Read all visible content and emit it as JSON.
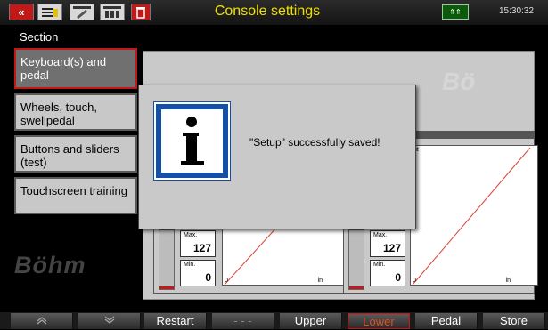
{
  "header": {
    "title": "Console settings",
    "back_label": "«",
    "transpose_label": "⇑⇑",
    "clock": "15:30:32"
  },
  "section_label": "Section",
  "sidebar": {
    "items": [
      {
        "label": "Keyboard(s) and pedal",
        "selected": true
      },
      {
        "label": "Wheels, touch, swellpedal"
      },
      {
        "label": "Buttons and sliders (test)"
      },
      {
        "label": "Touchscreen training"
      }
    ]
  },
  "panel": {
    "ghost_brand": "Bö",
    "curve_title_right": "ht",
    "graph_top_label": "ut",
    "max_label": "Max.",
    "max_value": "127",
    "min_label": "Min.",
    "min_value": "0",
    "axis_zero": "0",
    "axis_in": "in"
  },
  "modal": {
    "message": "\"Setup\" successfully saved!",
    "icon": "info-icon"
  },
  "brand_logo": "Böhm",
  "bottom_bar": {
    "buttons": [
      {
        "label": "«"
      },
      {
        "label": "»"
      },
      {
        "label": "Restart"
      },
      {
        "label": "- - -"
      },
      {
        "label": "Upper"
      },
      {
        "label": "Lower",
        "active": true
      },
      {
        "label": "Pedal"
      },
      {
        "label": "Store"
      }
    ]
  },
  "colors": {
    "accent_red": "#c21818",
    "title_yellow": "#f0e000",
    "info_blue": "#1450a8"
  }
}
